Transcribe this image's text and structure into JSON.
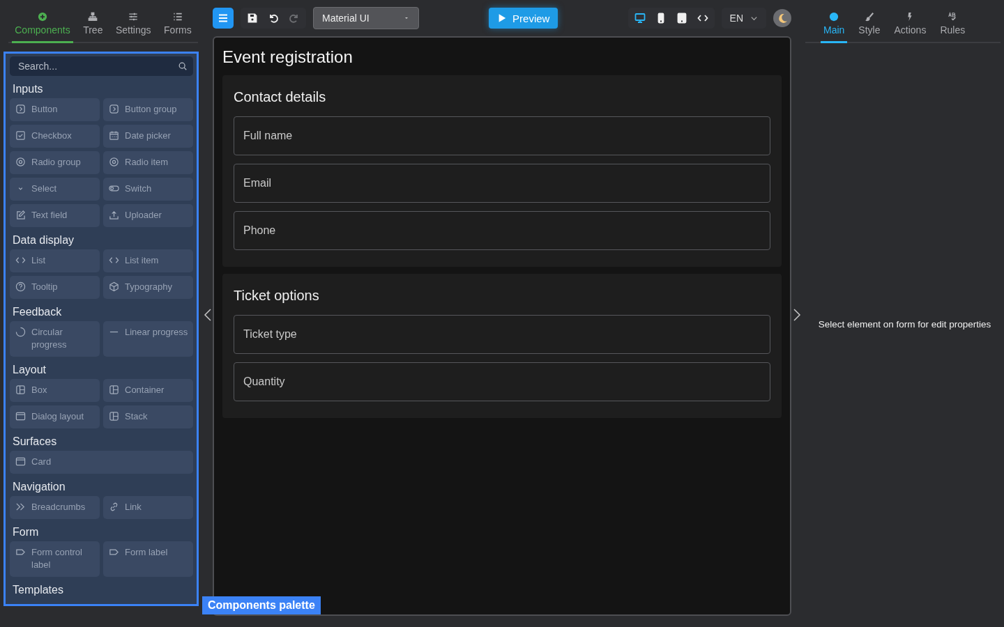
{
  "left_tabs": [
    {
      "label": "Components",
      "kind": "plus",
      "selected": true
    },
    {
      "label": "Tree",
      "kind": "tree",
      "selected": false
    },
    {
      "label": "Settings",
      "kind": "sliders",
      "selected": false
    },
    {
      "label": "Forms",
      "kind": "list",
      "selected": false
    }
  ],
  "palette": {
    "search": {
      "placeholder": "Search..."
    },
    "groups": [
      {
        "title": "Inputs",
        "items": [
          {
            "label": "Button",
            "kind": "chevron"
          },
          {
            "label": "Button group",
            "kind": "chevron"
          },
          {
            "label": "Checkbox",
            "kind": "check"
          },
          {
            "label": "Date picker",
            "kind": "calendar"
          },
          {
            "label": "Radio group",
            "kind": "radio"
          },
          {
            "label": "Radio item",
            "kind": "radio"
          },
          {
            "label": "Select",
            "kind": "caret"
          },
          {
            "label": "Switch",
            "kind": "toggle"
          },
          {
            "label": "Text field",
            "kind": "pencil"
          },
          {
            "label": "Uploader",
            "kind": "upload"
          }
        ]
      },
      {
        "title": "Data display",
        "items": [
          {
            "label": "List",
            "kind": "code"
          },
          {
            "label": "List item",
            "kind": "code"
          },
          {
            "label": "Tooltip",
            "kind": "help"
          },
          {
            "label": "Typography",
            "kind": "cube"
          }
        ]
      },
      {
        "title": "Feedback",
        "items": [
          {
            "label": "Circular progress",
            "kind": "spinner"
          },
          {
            "label": "Linear progress",
            "kind": "dash"
          }
        ]
      },
      {
        "title": "Layout",
        "items": [
          {
            "label": "Box",
            "kind": "grid"
          },
          {
            "label": "Container",
            "kind": "grid"
          },
          {
            "label": "Dialog layout",
            "kind": "window"
          },
          {
            "label": "Stack",
            "kind": "grid"
          }
        ]
      },
      {
        "title": "Surfaces",
        "items": [
          {
            "label": "Card",
            "kind": "window",
            "wide": true
          }
        ]
      },
      {
        "title": "Navigation",
        "items": [
          {
            "label": "Breadcrumbs",
            "kind": "double-chevron"
          },
          {
            "label": "Link",
            "kind": "link"
          }
        ]
      },
      {
        "title": "Form",
        "items": [
          {
            "label": "Form control label",
            "kind": "tag"
          },
          {
            "label": "Form label",
            "kind": "tag"
          }
        ]
      },
      {
        "title": "Templates"
      }
    ],
    "badge": "Components palette"
  },
  "toolbar": {
    "history": [
      {
        "kind": "save",
        "disabled": false
      },
      {
        "kind": "undo",
        "disabled": false
      },
      {
        "kind": "redo",
        "disabled": true
      }
    ],
    "library": "Material UI",
    "preview": "Preview",
    "devices": [
      {
        "kind": "desktop",
        "selected": true
      },
      {
        "kind": "phone",
        "selected": false
      },
      {
        "kind": "tablet",
        "selected": false
      },
      {
        "kind": "code",
        "selected": false
      }
    ],
    "language": "EN"
  },
  "form": {
    "title": "Event registration",
    "sections": [
      {
        "title": "Contact details",
        "fields": [
          {
            "placeholder": "Full name"
          },
          {
            "placeholder": "Email"
          },
          {
            "placeholder": "Phone"
          }
        ]
      },
      {
        "title": "Ticket options",
        "fields": [
          {
            "placeholder": "Ticket type"
          },
          {
            "placeholder": "Quantity"
          }
        ]
      }
    ]
  },
  "right_tabs": [
    {
      "label": "Main",
      "kind": "dot",
      "selected": true
    },
    {
      "label": "Style",
      "kind": "brush",
      "selected": false
    },
    {
      "label": "Actions",
      "kind": "bolt",
      "selected": false
    },
    {
      "label": "Rules",
      "kind": "spell",
      "selected": false
    }
  ],
  "properties_hint": "Select element on form for edit properties"
}
